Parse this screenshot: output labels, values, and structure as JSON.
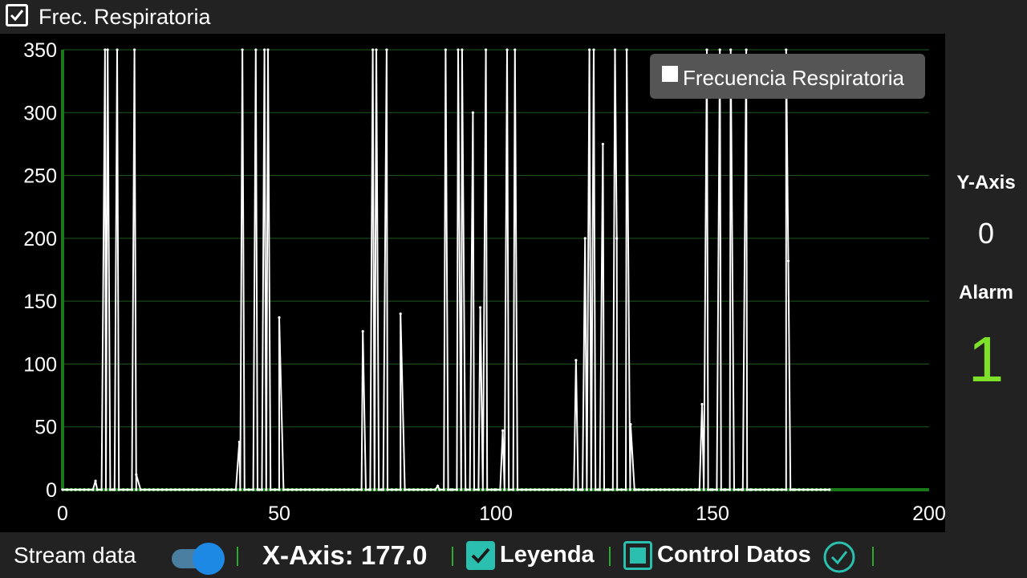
{
  "header": {
    "title": "Frec. Respiratoria",
    "title_checked": true
  },
  "chart_data": {
    "type": "line",
    "title": "",
    "xlabel": "",
    "ylabel": "",
    "xlim": [
      0,
      200
    ],
    "ylim": [
      0,
      350
    ],
    "x_ticks": [
      "0",
      "50",
      "100",
      "150",
      "200"
    ],
    "y_ticks": [
      "0",
      "50",
      "100",
      "150",
      "200",
      "250",
      "300",
      "350"
    ],
    "grid": true,
    "legend_position": "top-right",
    "series": [
      {
        "name": "Frecuencia Respiratoria",
        "color": "#ffffff",
        "points": [
          [
            0,
            0
          ],
          [
            1,
            0
          ],
          [
            2,
            0
          ],
          [
            3,
            0
          ],
          [
            4,
            0
          ],
          [
            5,
            0
          ],
          [
            6,
            0
          ],
          [
            7,
            0
          ],
          [
            8,
            0
          ],
          [
            9,
            0
          ],
          [
            10,
            0
          ],
          [
            11,
            0
          ],
          [
            12,
            0
          ],
          [
            13,
            0
          ],
          [
            14,
            0
          ],
          [
            15,
            0
          ],
          [
            16,
            0
          ],
          [
            17,
            0
          ],
          [
            18,
            0
          ],
          [
            19,
            0
          ],
          [
            20,
            0
          ],
          [
            21,
            0
          ],
          [
            22,
            0
          ],
          [
            23,
            0
          ],
          [
            24,
            0
          ],
          [
            25,
            0
          ],
          [
            26,
            0
          ],
          [
            27,
            0
          ],
          [
            28,
            0
          ],
          [
            29,
            0
          ],
          [
            30,
            0
          ],
          [
            31,
            0
          ],
          [
            32,
            0
          ],
          [
            33,
            0
          ],
          [
            34,
            0
          ],
          [
            35,
            0
          ],
          [
            36,
            0
          ],
          [
            37,
            0
          ],
          [
            38,
            0
          ],
          [
            39,
            0
          ],
          [
            40,
            0
          ],
          [
            41,
            0
          ],
          [
            42,
            0
          ],
          [
            43,
            0
          ],
          [
            44,
            0
          ],
          [
            45,
            0
          ],
          [
            46,
            0
          ],
          [
            47,
            0
          ],
          [
            48,
            0
          ],
          [
            49,
            0
          ],
          [
            50,
            0
          ],
          [
            51,
            0
          ],
          [
            52,
            0
          ],
          [
            53,
            0
          ],
          [
            54,
            0
          ],
          [
            55,
            0
          ],
          [
            56,
            0
          ],
          [
            57,
            0
          ],
          [
            58,
            0
          ],
          [
            59,
            0
          ],
          [
            60,
            0
          ],
          [
            61,
            0
          ],
          [
            62,
            0
          ],
          [
            63,
            0
          ],
          [
            64,
            0
          ],
          [
            65,
            0
          ],
          [
            66,
            0
          ],
          [
            67,
            0
          ],
          [
            68,
            0
          ],
          [
            69,
            0
          ],
          [
            70,
            0
          ],
          [
            71,
            0
          ],
          [
            72,
            0
          ],
          [
            73,
            0
          ],
          [
            74,
            0
          ],
          [
            75,
            0
          ],
          [
            76,
            0
          ],
          [
            77,
            0
          ],
          [
            78,
            0
          ],
          [
            79,
            0
          ],
          [
            80,
            0
          ],
          [
            81,
            0
          ],
          [
            82,
            0
          ],
          [
            83,
            0
          ],
          [
            84,
            0
          ],
          [
            85,
            0
          ],
          [
            86,
            0
          ],
          [
            87,
            0
          ],
          [
            88,
            0
          ],
          [
            89,
            0
          ],
          [
            90,
            0
          ],
          [
            91,
            0
          ],
          [
            92,
            0
          ],
          [
            93,
            0
          ],
          [
            94,
            0
          ],
          [
            95,
            0
          ],
          [
            96,
            0
          ],
          [
            97,
            0
          ],
          [
            98,
            0
          ],
          [
            99,
            0
          ],
          [
            100,
            0
          ],
          [
            101,
            0
          ],
          [
            102,
            0
          ],
          [
            103,
            0
          ],
          [
            104,
            0
          ],
          [
            105,
            0
          ],
          [
            106,
            0
          ],
          [
            107,
            0
          ],
          [
            108,
            0
          ],
          [
            109,
            0
          ],
          [
            110,
            0
          ],
          [
            111,
            0
          ],
          [
            112,
            0
          ],
          [
            113,
            0
          ],
          [
            114,
            0
          ],
          [
            115,
            0
          ],
          [
            116,
            0
          ],
          [
            117,
            0
          ],
          [
            118,
            0
          ],
          [
            119,
            0
          ],
          [
            120,
            0
          ],
          [
            121,
            0
          ],
          [
            122,
            0
          ],
          [
            123,
            0
          ],
          [
            124,
            0
          ],
          [
            125,
            0
          ],
          [
            126,
            0
          ],
          [
            127,
            0
          ],
          [
            128,
            0
          ],
          [
            129,
            0
          ],
          [
            130,
            0
          ],
          [
            131,
            0
          ],
          [
            132,
            0
          ],
          [
            133,
            0
          ],
          [
            134,
            0
          ],
          [
            135,
            0
          ],
          [
            136,
            0
          ],
          [
            137,
            0
          ],
          [
            138,
            0
          ],
          [
            139,
            0
          ],
          [
            140,
            0
          ],
          [
            141,
            0
          ],
          [
            142,
            0
          ],
          [
            143,
            0
          ],
          [
            144,
            0
          ],
          [
            145,
            0
          ],
          [
            146,
            0
          ],
          [
            147,
            0
          ],
          [
            148,
            0
          ],
          [
            149,
            0
          ],
          [
            150,
            0
          ],
          [
            151,
            0
          ],
          [
            152,
            0
          ],
          [
            153,
            0
          ],
          [
            154,
            0
          ],
          [
            155,
            0
          ],
          [
            156,
            0
          ],
          [
            157,
            0
          ],
          [
            158,
            0
          ],
          [
            159,
            0
          ],
          [
            160,
            0
          ],
          [
            161,
            0
          ],
          [
            162,
            0
          ],
          [
            163,
            0
          ],
          [
            164,
            0
          ],
          [
            165,
            0
          ],
          [
            166,
            0
          ],
          [
            167,
            0
          ],
          [
            168,
            0
          ],
          [
            169,
            0
          ],
          [
            170,
            0
          ],
          [
            171,
            0
          ],
          [
            172,
            0
          ],
          [
            173,
            0
          ],
          [
            174,
            0
          ],
          [
            175,
            0
          ],
          [
            176,
            0
          ],
          [
            177,
            0
          ]
        ]
      }
    ],
    "spikes": [
      [
        7.6,
        7
      ],
      [
        9.8,
        350
      ],
      [
        10.4,
        350
      ],
      [
        11.6,
        0
      ],
      [
        12.6,
        350
      ],
      [
        16.6,
        350
      ],
      [
        17,
        12
      ],
      [
        40.8,
        38
      ],
      [
        41.5,
        350
      ],
      [
        44.6,
        350
      ],
      [
        45.4,
        0
      ],
      [
        46.6,
        350
      ],
      [
        47.4,
        350
      ],
      [
        49,
        0
      ],
      [
        50,
        137
      ],
      [
        69.3,
        126
      ],
      [
        70.8,
        0
      ],
      [
        71.6,
        350
      ],
      [
        72.4,
        350
      ],
      [
        73.6,
        0
      ],
      [
        74.8,
        350
      ],
      [
        78,
        140
      ],
      [
        79,
        0
      ],
      [
        86.6,
        3
      ],
      [
        88.4,
        350
      ],
      [
        89.6,
        0
      ],
      [
        91.3,
        350
      ],
      [
        92.2,
        350
      ],
      [
        93.2,
        0
      ],
      [
        94.7,
        300
      ],
      [
        96.4,
        145
      ],
      [
        97.7,
        350
      ],
      [
        99.7,
        0
      ],
      [
        101.6,
        47
      ],
      [
        102.6,
        350
      ],
      [
        104.4,
        350
      ],
      [
        118.5,
        103
      ],
      [
        119.6,
        0
      ],
      [
        120.6,
        200
      ],
      [
        121.6,
        350
      ],
      [
        122.6,
        350
      ],
      [
        123.6,
        0
      ],
      [
        124.7,
        275
      ],
      [
        125.6,
        0
      ],
      [
        127.5,
        350
      ],
      [
        127.9,
        200
      ],
      [
        130.2,
        350
      ],
      [
        131.1,
        52
      ],
      [
        132.3,
        0
      ],
      [
        146.7,
        0
      ],
      [
        147.6,
        68
      ],
      [
        148.7,
        350
      ],
      [
        149.6,
        0
      ],
      [
        151.7,
        350
      ],
      [
        152.7,
        0
      ],
      [
        154.2,
        350
      ],
      [
        156.7,
        0
      ],
      [
        157.8,
        350
      ],
      [
        158.7,
        0
      ],
      [
        167,
        350
      ],
      [
        167.5,
        182
      ],
      [
        168.6,
        0
      ]
    ],
    "point_markers": true
  },
  "legend": {
    "label": "Frecuencia Respiratoria",
    "color": "#ffffff"
  },
  "side_panel": {
    "y_axis_heading": "Y-Axis",
    "y_axis_value": "0",
    "alarm_heading": "Alarm",
    "alarm_value": "1",
    "alarm_color": "#7fe02a"
  },
  "bottom_bar": {
    "stream_label": "Stream data",
    "stream_on": true,
    "x_axis_label": "X-Axis: 177.0",
    "leyenda_label": "Leyenda",
    "leyenda_checked": true,
    "control_label": "Control Datos",
    "accent_color": "#2abfae",
    "separator_color": "#2eaa2e"
  }
}
